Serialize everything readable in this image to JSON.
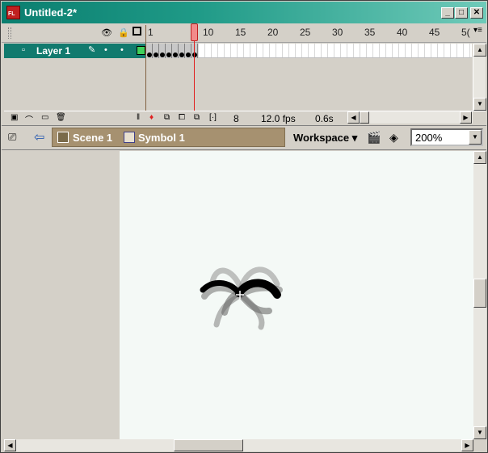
{
  "window": {
    "title": "Untitled-2*",
    "app_icon_label": "FL",
    "minimize_glyph": "_",
    "maximize_glyph": "□",
    "close_glyph": "✕"
  },
  "timeline": {
    "ruler_numbers": [
      "1",
      "10",
      "15",
      "20",
      "25",
      "30",
      "35",
      "40",
      "45",
      "5("
    ],
    "layer_name": "Layer 1",
    "status": {
      "current_frame": "8",
      "frame_rate": "12.0 fps",
      "elapsed": "0.6s"
    }
  },
  "editbar": {
    "scene_label": "Scene 1",
    "symbol_label": "Symbol 1",
    "workspace_label": "Workspace",
    "zoom_value": "200%"
  },
  "icons": {
    "eye": "eye-icon",
    "lock": "lock-icon",
    "outline": "outline-icon",
    "pencil": "pencil-icon",
    "back": "back-arrow-icon"
  },
  "colors": {
    "titlebar": "#0a7e6f",
    "layer_selected": "#117a6e",
    "playhead": "#e02020",
    "breadcrumb": "#a69170",
    "stage": "#f4f9f6"
  }
}
